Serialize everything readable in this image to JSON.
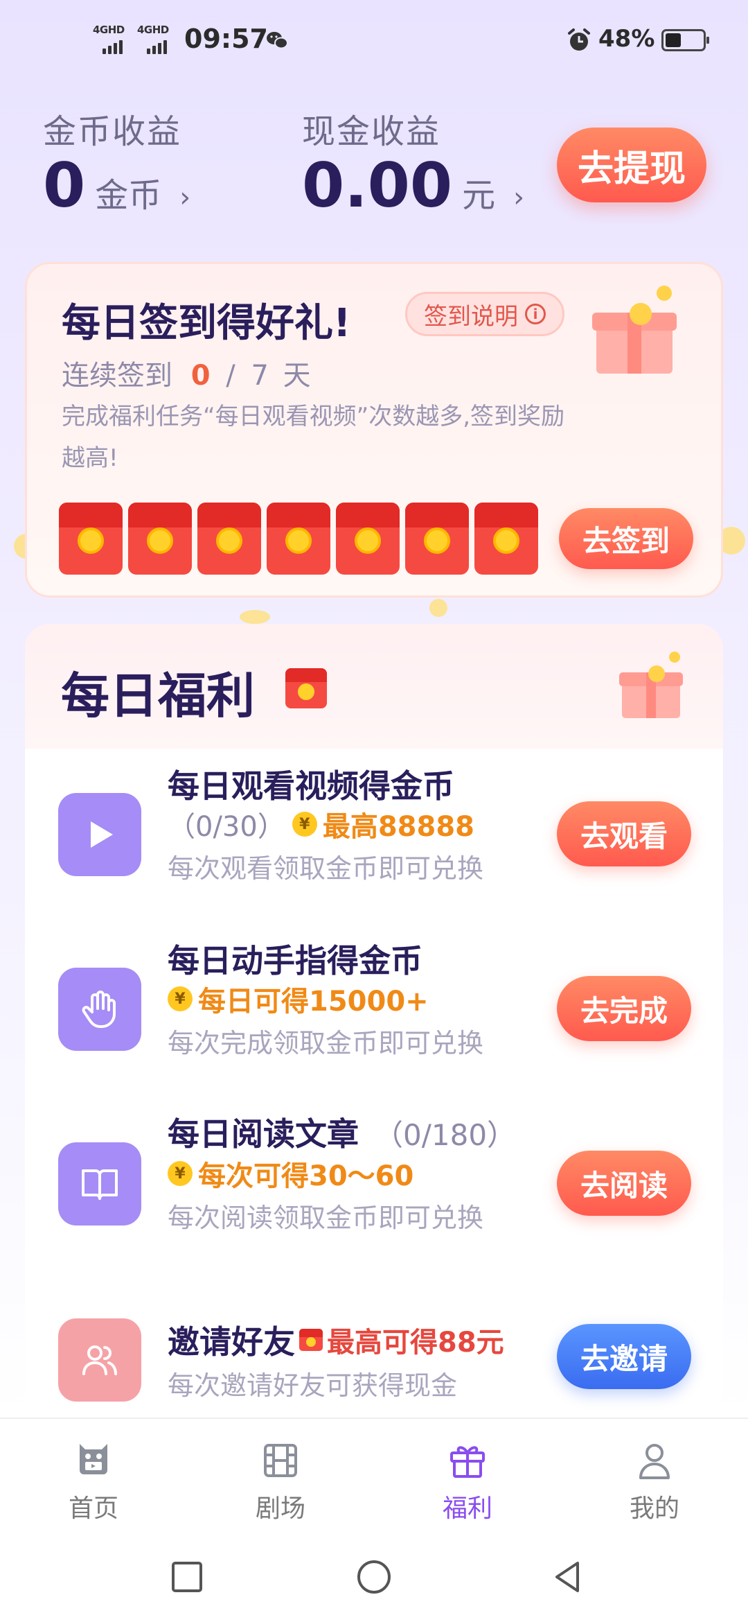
{
  "status_bar": {
    "network_1": "4GHD",
    "network_2": "4GHD",
    "time": "09:57",
    "battery": "48%"
  },
  "earnings": {
    "coin_label": "金币收益",
    "coin_value": "0",
    "coin_unit": "金币",
    "cash_label": "现金收益",
    "cash_value": "0.00",
    "cash_unit": "元",
    "chevron": "›",
    "withdraw_label": "去提现"
  },
  "signin": {
    "title": "每日签到得好礼!",
    "help_label": "签到说明",
    "streak_prefix": "连续签到",
    "streak_current": "0",
    "streak_sep": "/",
    "streak_total": "7",
    "streak_unit": "天",
    "desc": "完成福利任务“每日观看视频”次数越多,签到奖励越高!",
    "envelopes": 7,
    "button": "去签到"
  },
  "welfare": {
    "title": "每日福利",
    "tasks": [
      {
        "icon": "play-icon",
        "title": "每日观看视频得金币",
        "progress": "（0/30）",
        "reward": "最高88888",
        "sub": "每次观看领取金币即可兑换",
        "button": "去观看"
      },
      {
        "icon": "hand-icon",
        "title": "每日动手指得金币",
        "reward": "每日可得15000+",
        "sub": "每次完成领取金币即可兑换",
        "button": "去完成"
      },
      {
        "icon": "book-icon",
        "title": "每日阅读文章",
        "progress": "（0/180）",
        "reward": "每次可得30～60",
        "sub": "每次阅读领取金币即可兑换",
        "button": "去阅读"
      },
      {
        "icon": "users-icon",
        "title": "邀请好友",
        "reward": "最高可得88元",
        "sub": "每次邀请好友可获得现金",
        "button": "去邀请"
      }
    ]
  },
  "bottom_nav": {
    "items": [
      {
        "label": "首页",
        "icon": "home-mascot-icon"
      },
      {
        "label": "剧场",
        "icon": "film-icon"
      },
      {
        "label": "福利",
        "icon": "gift-icon",
        "active": true
      },
      {
        "label": "我的",
        "icon": "person-icon"
      }
    ]
  },
  "colors": {
    "accent": "#8a4dee",
    "orange_button": "#ff5a4e",
    "blue_button": "#3a6cf0",
    "title": "#2a1e5c"
  }
}
